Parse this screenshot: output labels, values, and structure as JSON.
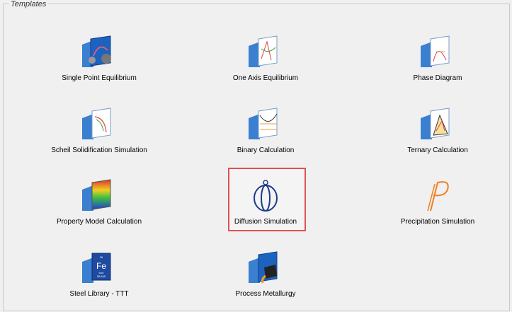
{
  "panel": {
    "title": "Templates"
  },
  "templates": [
    {
      "label": "Single Point Equilibrium",
      "icon": "single-point-equilibrium-icon"
    },
    {
      "label": "One Axis Equilibrium",
      "icon": "one-axis-equilibrium-icon"
    },
    {
      "label": "Phase Diagram",
      "icon": "phase-diagram-icon"
    },
    {
      "label": "Scheil Solidification Simulation",
      "icon": "scheil-solidification-icon"
    },
    {
      "label": "Binary Calculation",
      "icon": "binary-calculation-icon"
    },
    {
      "label": "Ternary Calculation",
      "icon": "ternary-calculation-icon"
    },
    {
      "label": "Property Model Calculation",
      "icon": "property-model-icon"
    },
    {
      "label": "Diffusion Simulation",
      "icon": "diffusion-simulation-icon",
      "selected": true
    },
    {
      "label": "Precipitation Simulation",
      "icon": "precipitation-simulation-icon"
    },
    {
      "label": "Steel Library - TTT",
      "icon": "steel-library-icon",
      "element_symbol": "Fe",
      "element_number": "26",
      "element_name": "Iron",
      "element_mass": "55.845"
    },
    {
      "label": "Process Metallurgy",
      "icon": "process-metallurgy-icon"
    }
  ]
}
